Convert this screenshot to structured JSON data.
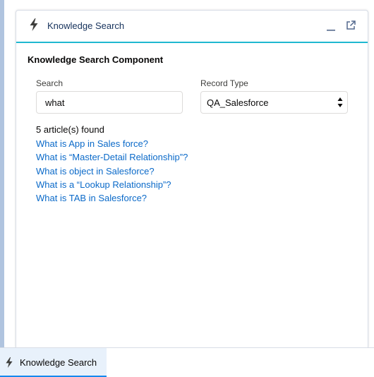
{
  "panel": {
    "title": "Knowledge Search",
    "minimize_icon": "minimize-icon",
    "popout_icon": "popout-icon",
    "header_icon": "lightning-bolt-icon"
  },
  "component": {
    "title": "Knowledge Search Component",
    "search": {
      "label": "Search",
      "value": "what"
    },
    "record_type": {
      "label": "Record Type",
      "selected": "QA_Salesforce"
    },
    "results_count": "5 article(s) found",
    "results": [
      "What is App in Sales force?",
      "What is “Master-Detail Relationship”?",
      "What is object in Salesforce?",
      "What is a “Lookup Relationship”?",
      "What is TAB in Salesforce?"
    ]
  },
  "utility_bar": {
    "tab_label": "Knowledge Search",
    "tab_icon": "lightning-bolt-icon"
  },
  "colors": {
    "accent_line": "#1fb8d0",
    "link": "#0b6ac9",
    "utility_tab_bg": "#e8f1fb",
    "utility_tab_underline": "#1589ee",
    "left_strip": "#b0c4df"
  }
}
